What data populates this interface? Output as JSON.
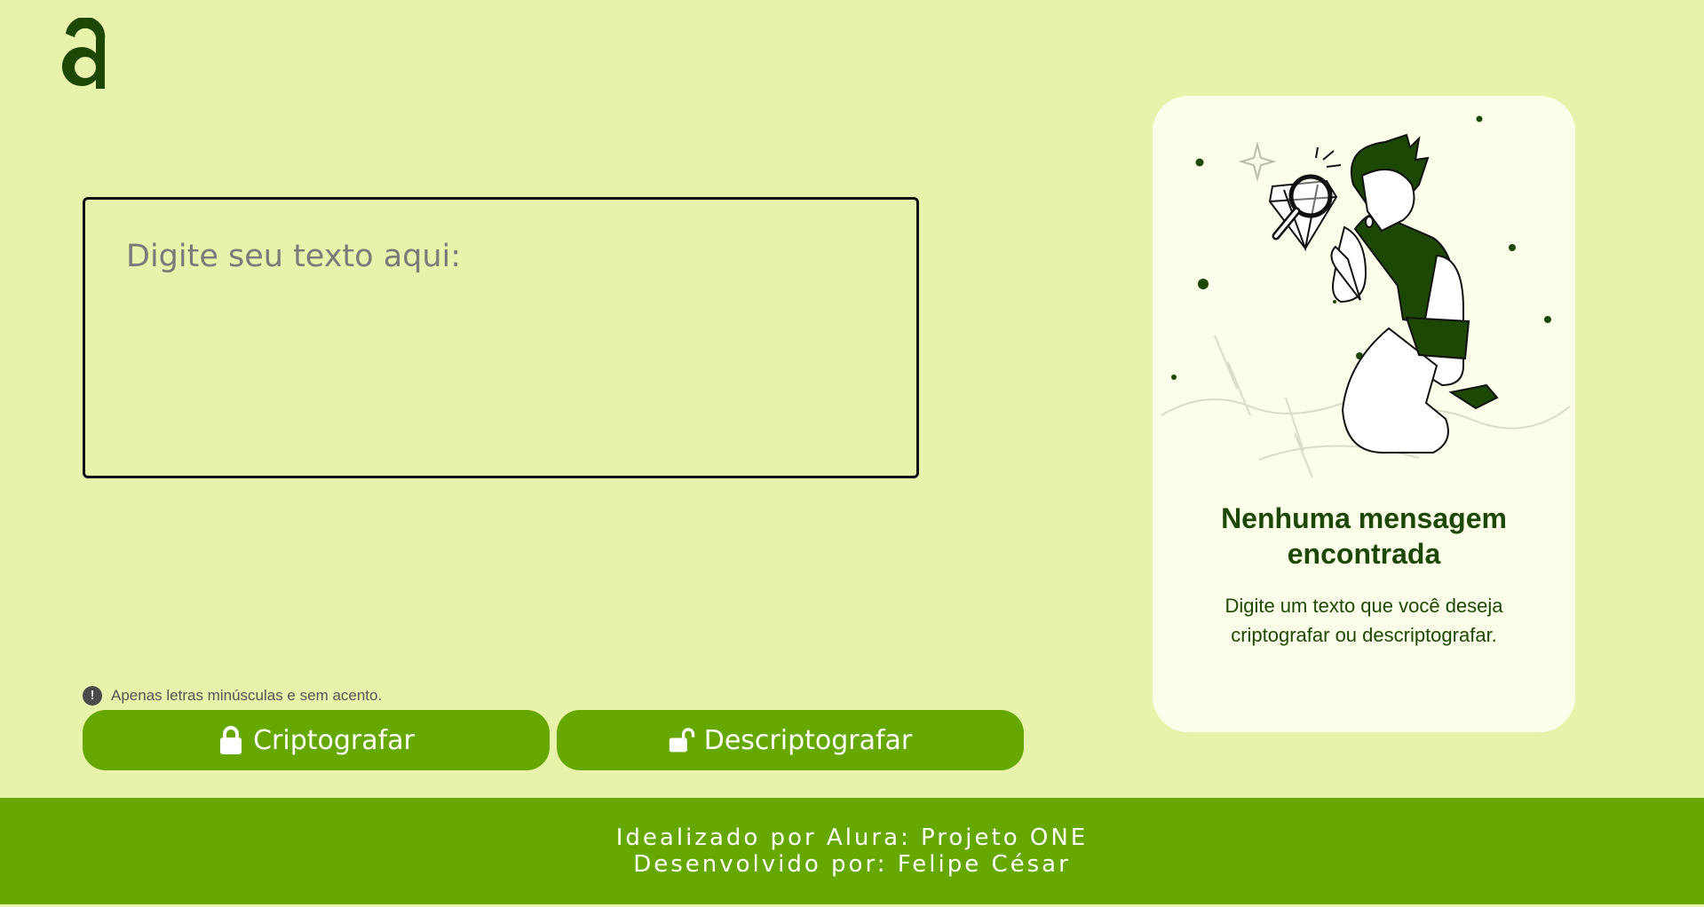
{
  "header": {
    "logo": "alura-logo-icon"
  },
  "input": {
    "placeholder": "Digite seu texto aqui:"
  },
  "hint": {
    "icon": "exclamation-icon",
    "text": "Apenas letras minúsculas e sem acento."
  },
  "buttons": {
    "encrypt": {
      "label": "Criptografar",
      "icon": "lock-icon"
    },
    "decrypt": {
      "label": "Descriptografar",
      "icon": "unlock-icon"
    }
  },
  "output": {
    "title": "Nenhuma mensagem encontrada",
    "description": "Digite um texto que você deseja criptografar ou descriptografar."
  },
  "footer": {
    "line1": "Idealizado por Alura: Projeto ONE",
    "line2": "Desenvolvido por: Felipe César"
  },
  "colors": {
    "background": "#E9F2AB",
    "accent": "#66A800",
    "dark_green": "#1D4803",
    "card": "#FBFEE9"
  }
}
